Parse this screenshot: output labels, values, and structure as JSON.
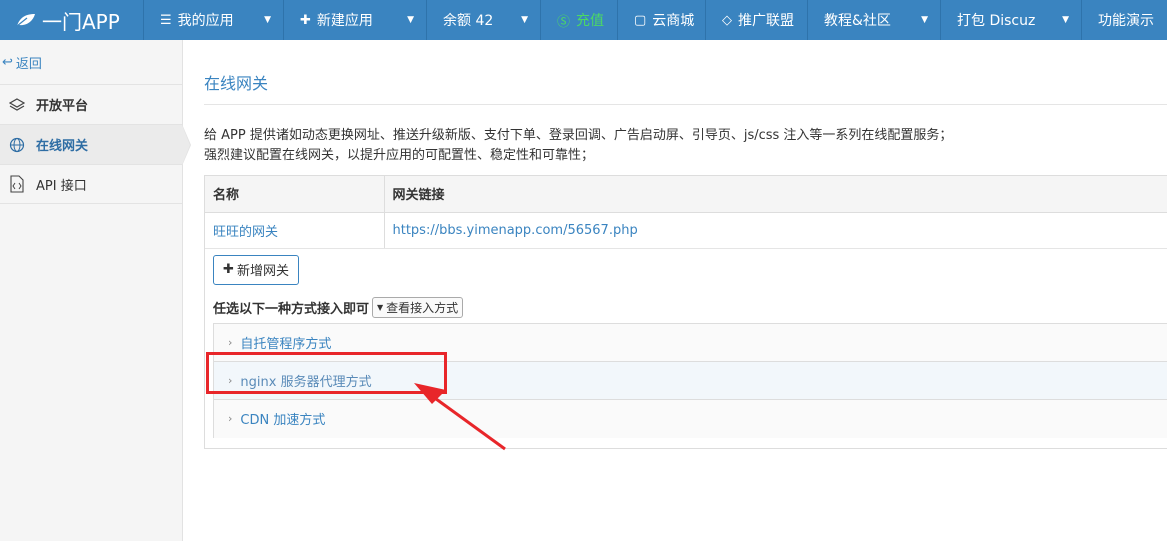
{
  "brand": {
    "name": "一门APP"
  },
  "topnav": {
    "my_apps": "我的应用",
    "new_app": "新建应用",
    "balance": "余额 42",
    "recharge": "充值",
    "cloud_store": "云商城",
    "affiliate": "推广联盟",
    "tutorial": "教程&社区",
    "pack_discuz": "打包 Discuz",
    "demo": "功能演示"
  },
  "sidebar": {
    "back": "返回",
    "items": [
      {
        "label": "开放平台"
      },
      {
        "label": "在线网关"
      },
      {
        "label": "API 接口"
      }
    ]
  },
  "main": {
    "title": "在线网关",
    "desc_line1": "给 APP 提供诸如动态更换网址、推送升级新版、支付下单、登录回调、广告启动屏、引导页、js/css 注入等一系列在线配置服务；",
    "desc_line2": "强烈建议配置在线网关，以提升应用的可配置性、稳定性和可靠性；",
    "table": {
      "headers": [
        "名称",
        "网关链接"
      ],
      "rows": [
        {
          "name": "旺旺的网关",
          "link": "https://bbs.yimenapp.com/56567.php"
        }
      ]
    },
    "add_button": "新增网关",
    "choose_label": "任选以下一种方式接入即可",
    "view_button": "查看接入方式",
    "methods": [
      {
        "label": "自托管程序方式"
      },
      {
        "label": "nginx 服务器代理方式"
      },
      {
        "label": "CDN 加速方式"
      }
    ]
  },
  "colors": {
    "nav": "#3a84c0",
    "accent": "#3a84c0",
    "recharge": "#4cd964",
    "highlight": "#e8262a"
  }
}
